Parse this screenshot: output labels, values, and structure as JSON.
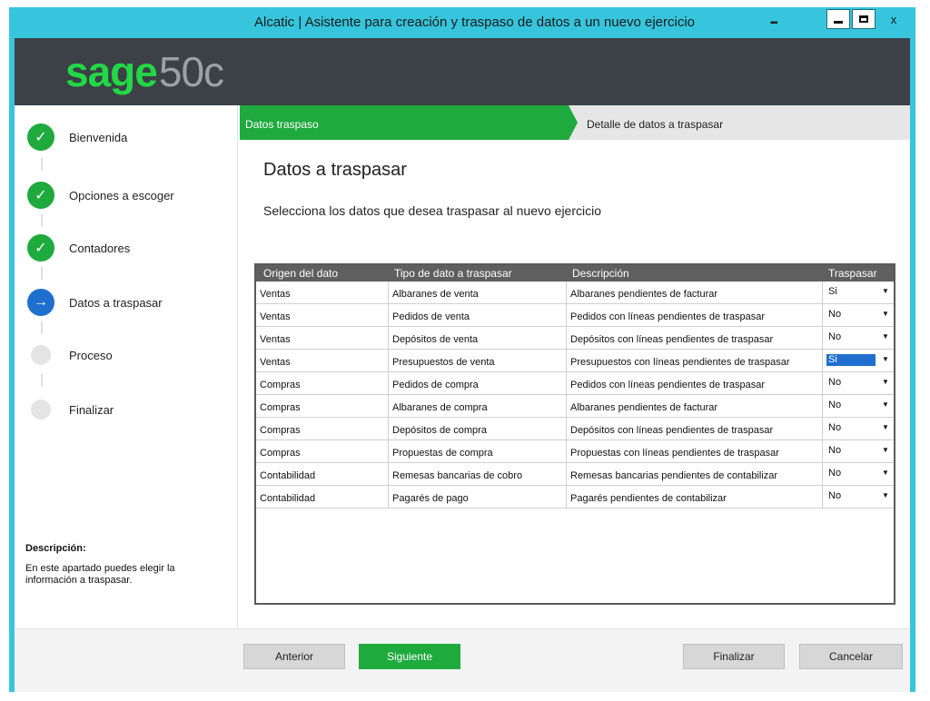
{
  "window": {
    "title": "Alcatic | Asistente para creación y traspaso de datos a un nuevo ejercicio",
    "close": "x"
  },
  "logo": {
    "sage": "sage",
    "version": "50c"
  },
  "steps": [
    {
      "label": "Bienvenida",
      "state": "done"
    },
    {
      "label": "Opciones a escoger",
      "state": "done"
    },
    {
      "label": "Contadores",
      "state": "done"
    },
    {
      "label": "Datos a traspasar",
      "state": "current"
    },
    {
      "label": "Proceso",
      "state": "pending"
    },
    {
      "label": "Finalizar",
      "state": "pending"
    }
  ],
  "description": {
    "title": "Descripción:",
    "text": "En este apartado puedes elegir la información a traspasar."
  },
  "breadcrumb": {
    "active": "Datos traspaso",
    "next": "Detalle de datos a traspasar"
  },
  "content": {
    "title": "Datos a traspasar",
    "subtitle": "Selecciona los datos que desea traspasar al nuevo ejercicio"
  },
  "table": {
    "columns": [
      "Origen del dato",
      "Tipo de dato a traspasar",
      "Descripción",
      "Traspasar"
    ],
    "rows": [
      {
        "origen": "Ventas",
        "tipo": "Albaranes de venta",
        "descripcion": "Albaranes pendientes de facturar",
        "traspasar": "Si"
      },
      {
        "origen": "Ventas",
        "tipo": "Pedidos de venta",
        "descripcion": "Pedidos con líneas pendientes de traspasar",
        "traspasar": "No"
      },
      {
        "origen": "Ventas",
        "tipo": "Depósitos de venta",
        "descripcion": "Depósitos con líneas pendientes de traspasar",
        "traspasar": "No"
      },
      {
        "origen": "Ventas",
        "tipo": "Presupuestos de venta",
        "descripcion": "Presupuestos con líneas pendientes de traspasar",
        "traspasar": "Si"
      },
      {
        "origen": "Compras",
        "tipo": "Pedidos de compra",
        "descripcion": "Pedidos con líneas pendientes de traspasar",
        "traspasar": "No"
      },
      {
        "origen": "Compras",
        "tipo": "Albaranes de compra",
        "descripcion": "Albaranes pendientes de facturar",
        "traspasar": "No"
      },
      {
        "origen": "Compras",
        "tipo": "Depósitos de compra",
        "descripcion": "Depósitos con líneas pendientes de traspasar",
        "traspasar": "No"
      },
      {
        "origen": "Compras",
        "tipo": "Propuestas de compra",
        "descripcion": "Propuestas con líneas pendientes de traspasar",
        "traspasar": "No"
      },
      {
        "origen": "Contabilidad",
        "tipo": "Remesas bancarias de cobro",
        "descripcion": "Remesas bancarias pendientes de contabilizar",
        "traspasar": "No"
      },
      {
        "origen": "Contabilidad",
        "tipo": "Pagarés de pago",
        "descripcion": "Pagarés pendientes de contabilizar",
        "traspasar": "No"
      }
    ]
  },
  "footer": {
    "prev": "Anterior",
    "next": "Siguiente",
    "finish": "Finalizar",
    "cancel": "Cancelar"
  },
  "colors": {
    "accent_green": "#1eaa3d",
    "titlebar": "#36c5dc",
    "header": "#3b4147",
    "current_step": "#1f6fcf"
  },
  "icons": {
    "done": "check-icon",
    "current": "arrow-right-icon",
    "dropdown": "chevron-down-icon"
  }
}
